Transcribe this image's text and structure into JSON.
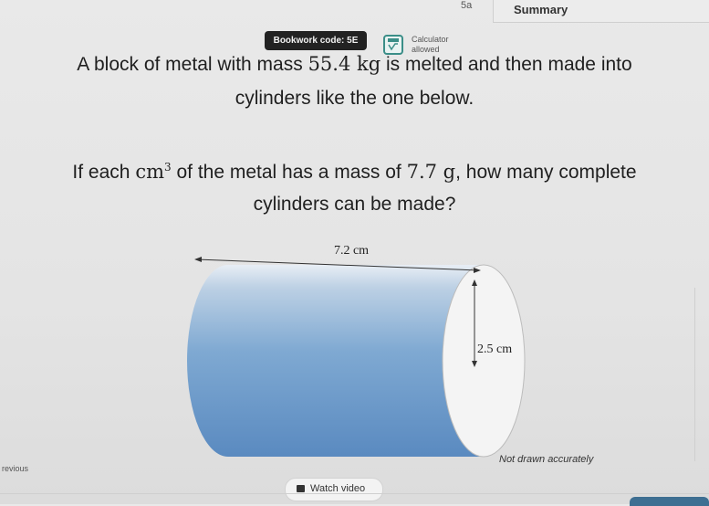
{
  "header": {
    "step": "5a",
    "summary_tab": "Summary"
  },
  "badges": {
    "bookwork_code": "Bookwork code: 5E",
    "calculator_line1": "Calculator",
    "calculator_line2": "allowed"
  },
  "question": {
    "line1_a": "A block of metal with mass ",
    "line1_mass": "55.4 kg",
    "line1_b": " is melted and then made into",
    "line2": "cylinders like the one below.",
    "line3_a": "If each ",
    "line3_unit": "cm",
    "line3_exp": "3",
    "line3_b": " of the metal has a mass of ",
    "line3_mass": "7.7 g",
    "line3_c": ", how many complete",
    "line4": "cylinders can be made?"
  },
  "diagram": {
    "length_label": "7.2 cm",
    "diameter_label": "2.5 cm",
    "note": "Not drawn accurately"
  },
  "footer": {
    "previous": "revious",
    "watch_video": "Watch video"
  },
  "colors": {
    "cylinder_body": "#6b9bc9",
    "cylinder_end": "#f4f4f4",
    "badge": "#222222",
    "accent": "#3b8e88"
  }
}
